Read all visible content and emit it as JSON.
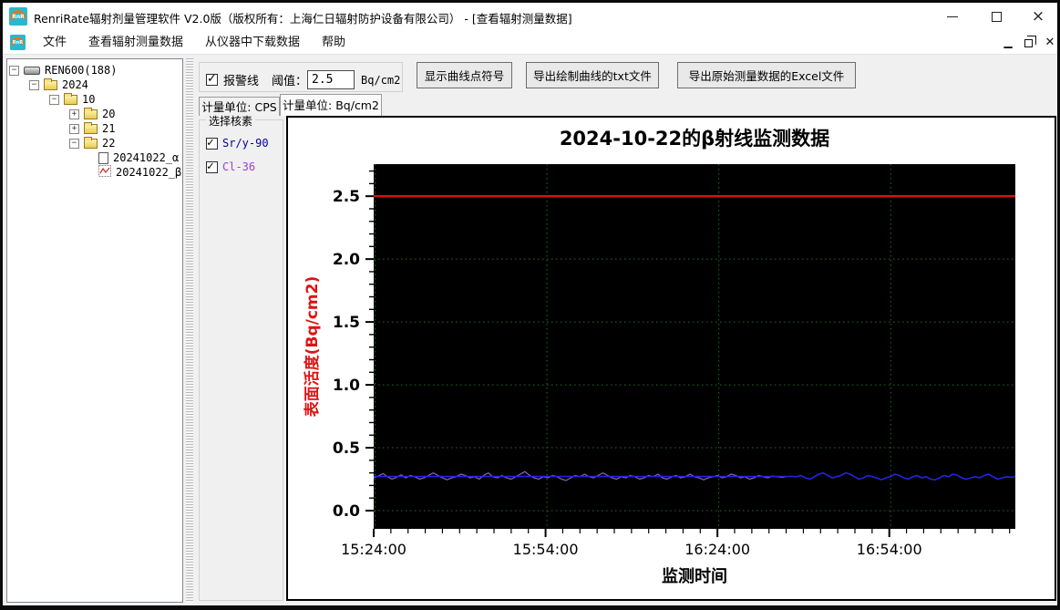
{
  "window": {
    "title": "RenriRate辐射剂量管理软件 V2.0版（版权所有：上海仁日辐射防护设备有限公司） - [查看辐射测量数据]",
    "controls": {
      "minimize": "–",
      "maximize": "□",
      "close": "×"
    }
  },
  "menu": {
    "items": [
      {
        "label": "文件"
      },
      {
        "label": "查看辐射测量数据"
      },
      {
        "label": "从仪器中下载数据"
      },
      {
        "label": "帮助"
      }
    ]
  },
  "tree": {
    "items": [
      {
        "level": 0,
        "box": "-",
        "icon": "device",
        "label": "REN600(188)"
      },
      {
        "level": 1,
        "box": "-",
        "icon": "folder",
        "label": "2024"
      },
      {
        "level": 2,
        "box": "-",
        "icon": "folder",
        "label": "10"
      },
      {
        "level": 3,
        "box": "+",
        "icon": "folder",
        "label": "20"
      },
      {
        "level": 3,
        "box": "+",
        "icon": "folder",
        "label": "21"
      },
      {
        "level": 3,
        "box": "-",
        "icon": "folder",
        "label": "22"
      },
      {
        "level": 4,
        "box": "",
        "icon": "doc",
        "label": "20241022_α"
      },
      {
        "level": 4,
        "box": "",
        "icon": "chart",
        "label": "20241022_β"
      }
    ]
  },
  "toolbar": {
    "alarm_checkbox_label": "报警线",
    "alarm_checked": true,
    "threshold_label": "阈值：",
    "threshold_value": "2.5",
    "threshold_unit": "Bq/cm2",
    "buttons": [
      "显示曲线点符号",
      "导出绘制曲线的txt文件",
      "导出原始测量数据的Excel文件"
    ]
  },
  "tabs": [
    {
      "label": "计量单位: CPS",
      "active": false
    },
    {
      "label": "计量单位: Bq/cm2",
      "active": true
    }
  ],
  "nuclide_panel": {
    "title": "选择核素",
    "items": [
      {
        "label": "Sr/y-90",
        "checked": true,
        "color": "#000099"
      },
      {
        "label": "Cl-36",
        "checked": true,
        "color": "#9a3fd0"
      }
    ]
  },
  "chart_data": {
    "type": "line",
    "title": "2024-10-22的β射线监测数据",
    "xlabel": "监测时间",
    "ylabel": "表面活度(Bq/cm2)",
    "plot_bg": "#000000",
    "grid_color": "#247024",
    "grid_on": true,
    "title_color": "#000000",
    "ylabel_color": "#e01212",
    "x_start_time": "15:24:00",
    "x_range_min": [
      0,
      112
    ],
    "x_major_ticks_min": [
      0,
      30,
      60,
      90
    ],
    "x_tick_labels": [
      "15:24:00",
      "15:54:00",
      "16:24:00",
      "16:54:00"
    ],
    "x_minor_step_min": 3,
    "ylim": [
      -0.145,
      2.755
    ],
    "y_major_ticks": [
      0.0,
      0.5,
      1.0,
      1.5,
      2.0,
      2.5
    ],
    "y_tick_labels": [
      "0.0",
      "0.5",
      "1.0",
      "1.5",
      "2.0",
      "2.5"
    ],
    "y_minor_step": 0.1,
    "alarm_line": {
      "value": 2.5,
      "color": "#dd1111"
    },
    "series": [
      {
        "name": "Cl-36",
        "color": "#8a5fd0",
        "width": 1.2,
        "segments": [
          {
            "start_min": 0,
            "step_min": 0.8,
            "values": [
              0.26,
              0.275,
              0.295,
              0.27,
              0.25,
              0.265,
              0.285,
              0.26,
              0.28,
              0.27,
              0.25,
              0.26,
              0.28,
              0.3,
              0.28,
              0.26,
              0.245,
              0.26,
              0.27,
              0.29,
              0.28,
              0.26,
              0.27,
              0.25,
              0.28,
              0.3,
              0.27,
              0.26,
              0.28,
              0.26,
              0.25,
              0.27,
              0.29,
              0.31,
              0.28,
              0.26,
              0.25,
              0.27,
              0.26,
              0.28,
              0.27,
              0.25,
              0.24,
              0.26,
              0.28,
              0.27,
              0.29,
              0.27,
              0.26,
              0.28,
              0.3,
              0.28,
              0.26,
              0.25,
              0.27,
              0.26,
              0.28,
              0.27,
              0.25,
              0.26,
              0.28,
              0.27,
              0.29,
              0.26,
              0.25,
              0.27,
              0.28,
              0.26,
              0.27,
              0.29,
              0.27,
              0.26,
              0.245,
              0.26,
              0.27,
              0.28,
              0.26,
              0.27,
              0.29,
              0.28,
              0.26,
              0.27,
              0.25,
              0.26,
              0.28,
              0.27,
              0.26,
              0.275,
              0.27,
              0.265,
              0.27
            ]
          }
        ]
      },
      {
        "name": "Sr/y-90",
        "color": "#2323e6",
        "width": 1.6,
        "segments": [
          {
            "start_min": 0,
            "step_min": 73,
            "values": [
              0.272,
              0.272
            ]
          },
          {
            "start_min": 73.8,
            "step_min": 0.78,
            "values": [
              0.27,
              0.28,
              0.26,
              0.25,
              0.27,
              0.29,
              0.3,
              0.28,
              0.26,
              0.27,
              0.28,
              0.3,
              0.29,
              0.27,
              0.25,
              0.26,
              0.28,
              0.27,
              0.26,
              0.245,
              0.26,
              0.27,
              0.29,
              0.28,
              0.26,
              0.25,
              0.27,
              0.28,
              0.26,
              0.27,
              0.25,
              0.245,
              0.26,
              0.28,
              0.27,
              0.29,
              0.28,
              0.26,
              0.25,
              0.26,
              0.27,
              0.26,
              0.28,
              0.29,
              0.27,
              0.25,
              0.26,
              0.27,
              0.265,
              0.27
            ]
          }
        ]
      }
    ]
  }
}
